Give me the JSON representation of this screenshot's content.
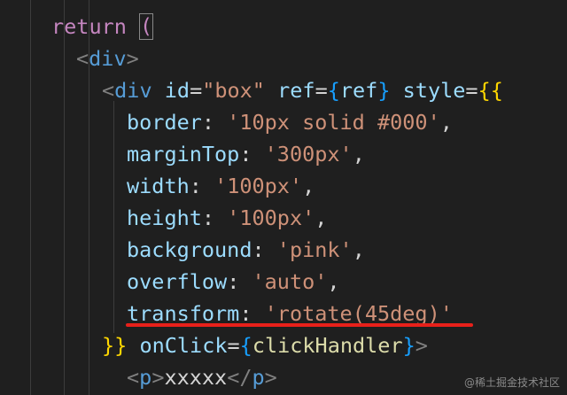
{
  "code": {
    "line1": {
      "keyword": "return",
      "paren": "("
    },
    "line2": {
      "open": "<",
      "tag": "div",
      "close": ">"
    },
    "line3": {
      "open": "<",
      "tag": "div",
      "attr1": "id",
      "eq1": "=",
      "val1": "\"box\"",
      "attr2": "ref",
      "eq2": "=",
      "brace_open": "{",
      "ref_value": "ref",
      "brace_close": "}",
      "attr3": "style",
      "eq3": "=",
      "style_open": "{{"
    },
    "props": [
      {
        "key": "border",
        "colon": ":",
        "value": "'10px solid #000'",
        "comma": ","
      },
      {
        "key": "marginTop",
        "colon": ":",
        "value": "'300px'",
        "comma": ","
      },
      {
        "key": "width",
        "colon": ":",
        "value": "'100px'",
        "comma": ","
      },
      {
        "key": "height",
        "colon": ":",
        "value": "'100px'",
        "comma": ","
      },
      {
        "key": "background",
        "colon": ":",
        "value": "'pink'",
        "comma": ","
      },
      {
        "key": "overflow",
        "colon": ":",
        "value": "'auto'",
        "comma": ","
      },
      {
        "key": "transform",
        "colon": ":",
        "value": "'rotate(45deg)'",
        "comma": ""
      }
    ],
    "line11": {
      "style_close": "}}",
      "attr": "onClick",
      "eq": "=",
      "brace_open": "{",
      "handler": "clickHandler",
      "brace_close": "}",
      "close": ">"
    },
    "line12": {
      "open": "<",
      "tag": "p",
      "close": ">",
      "text": "xxxxx",
      "end_open": "</",
      "end_tag": "p",
      "end_close": ">"
    }
  },
  "watermark": "@稀土掘金技术社区",
  "colors": {
    "background": "#1f1f1f",
    "keyword": "#c586c0",
    "tag": "#569cd6",
    "attribute": "#9cdcfe",
    "string": "#ce9178",
    "function": "#dcdcaa",
    "highlight_underline": "#e8201a"
  }
}
